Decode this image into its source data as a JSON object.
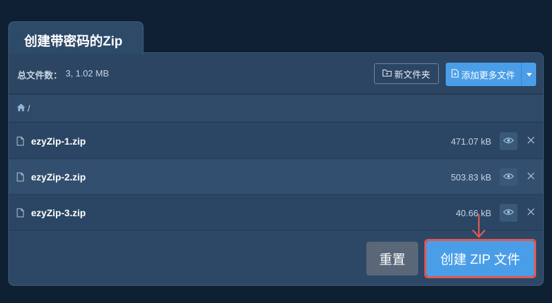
{
  "tab": {
    "title": "创建带密码的Zip"
  },
  "toolbar": {
    "total_label": "总文件数：",
    "total_value": "3, 1.02 MB",
    "new_folder_label": "新文件夹",
    "add_more_label": "添加更多文件"
  },
  "breadcrumb": {
    "separator": "/"
  },
  "files": [
    {
      "name": "ezyZip-1.zip",
      "size": "471.07 kB"
    },
    {
      "name": "ezyZip-2.zip",
      "size": "503.83 kB"
    },
    {
      "name": "ezyZip-3.zip",
      "size": "40.66 kB"
    }
  ],
  "actions": {
    "reset_label": "重置",
    "create_label": "创建 ZIP 文件"
  },
  "colors": {
    "accent": "#4a9ee8",
    "highlight": "#e05a52",
    "background": "#102033"
  }
}
